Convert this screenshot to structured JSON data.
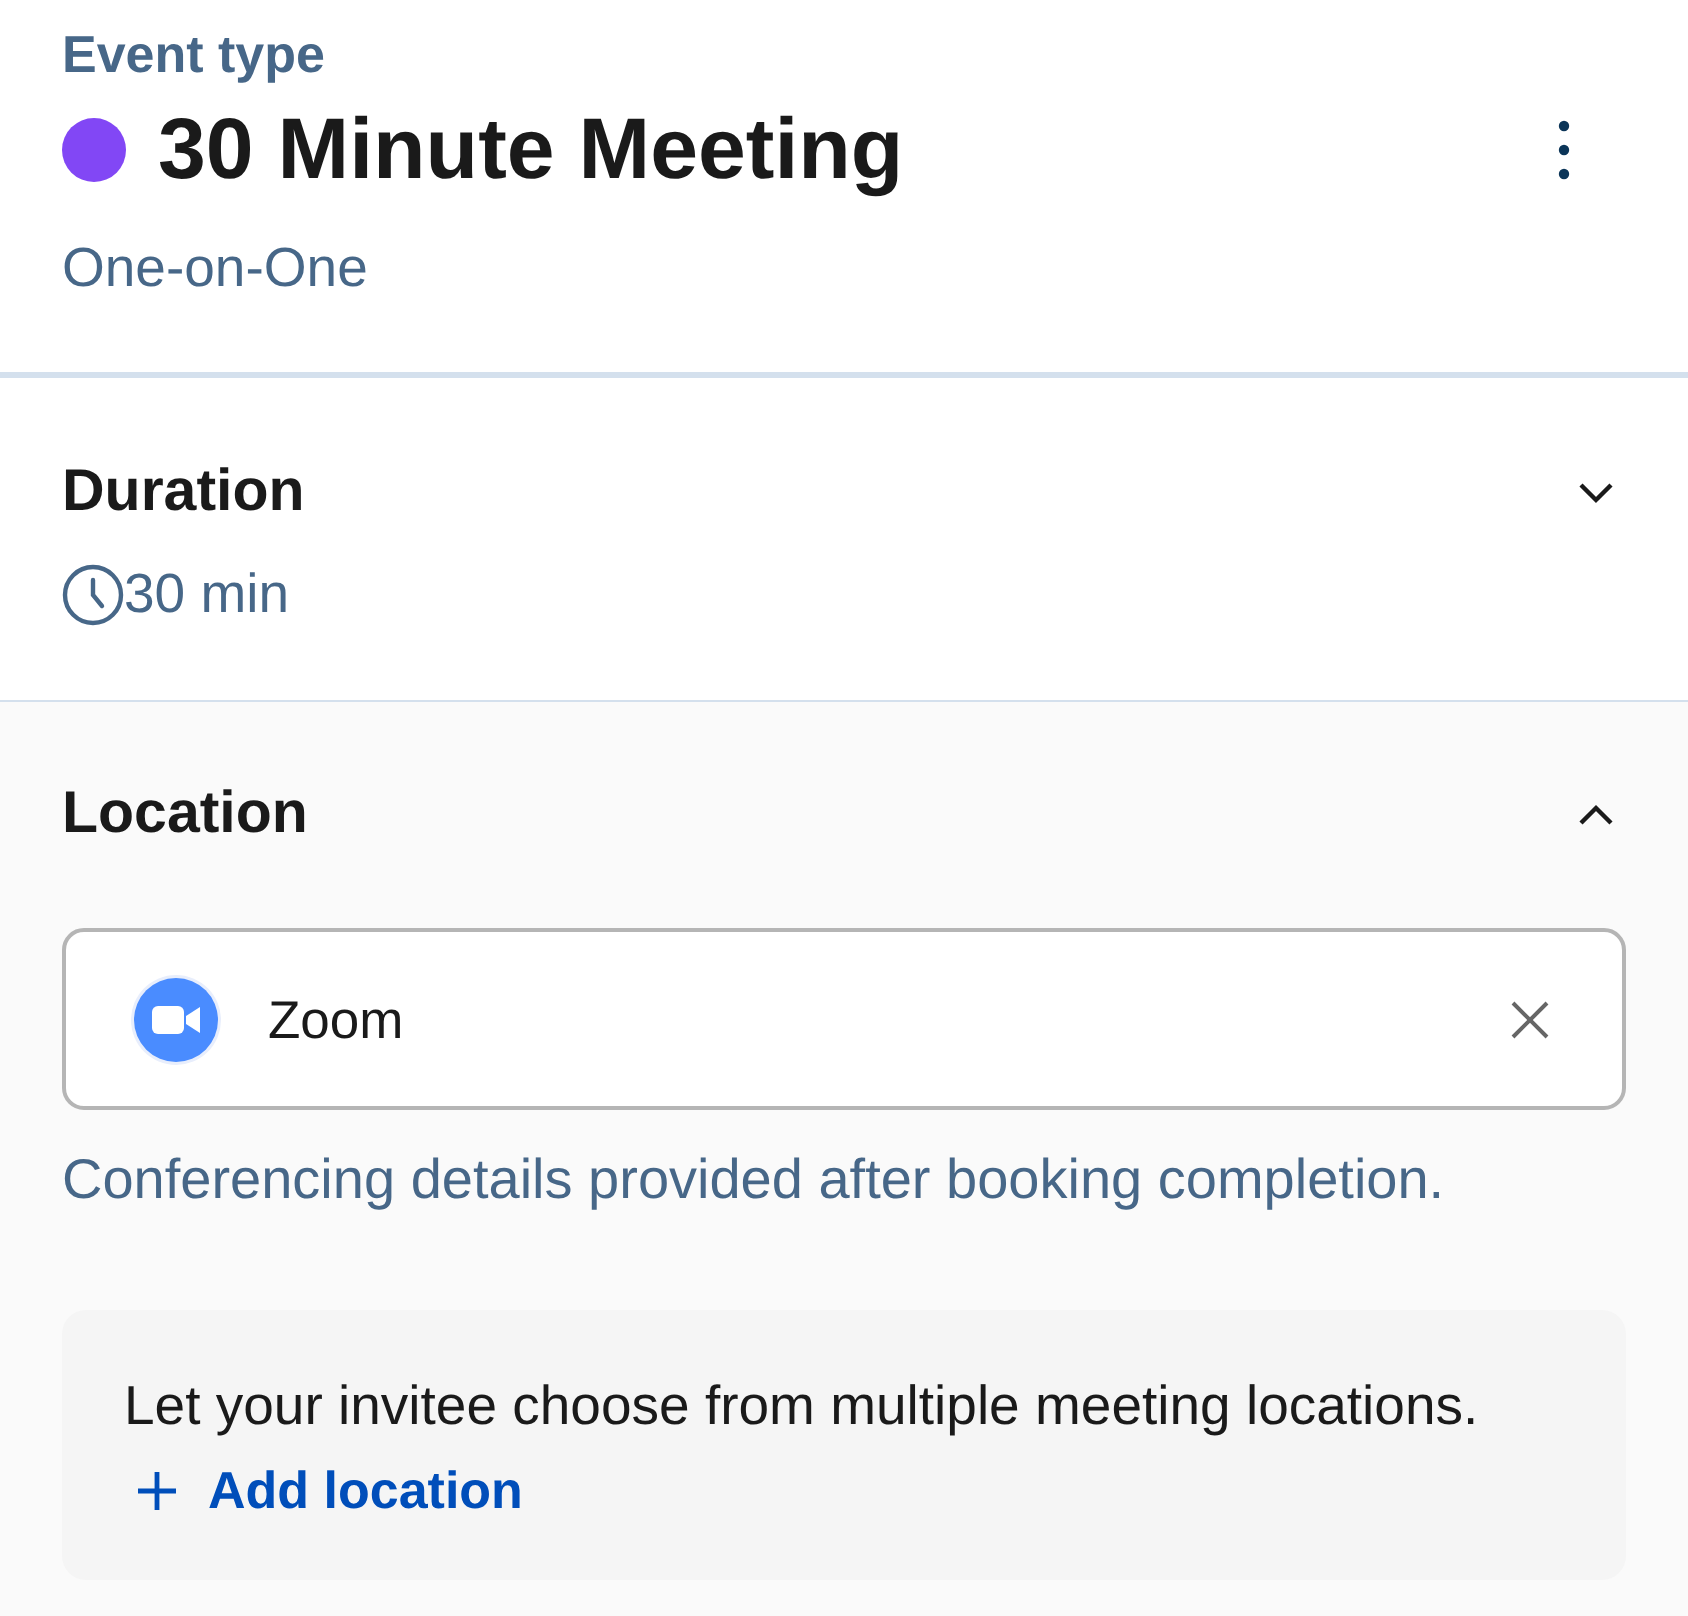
{
  "event_type": {
    "label": "Event type",
    "title": "30 Minute Meeting",
    "color": "#8247f5",
    "subtitle": "One-on-One"
  },
  "sections": [
    {
      "kind": "duration",
      "title": "Duration",
      "expanded": false,
      "summary": "30 min"
    },
    {
      "kind": "location",
      "title": "Location",
      "expanded": true,
      "location": {
        "name": "Zoom"
      },
      "helper": "Conferencing details provided after booking completion.",
      "multi": {
        "text": "Let your invitee choose from multiple meeting locations.",
        "link": "Add location"
      }
    }
  ]
}
